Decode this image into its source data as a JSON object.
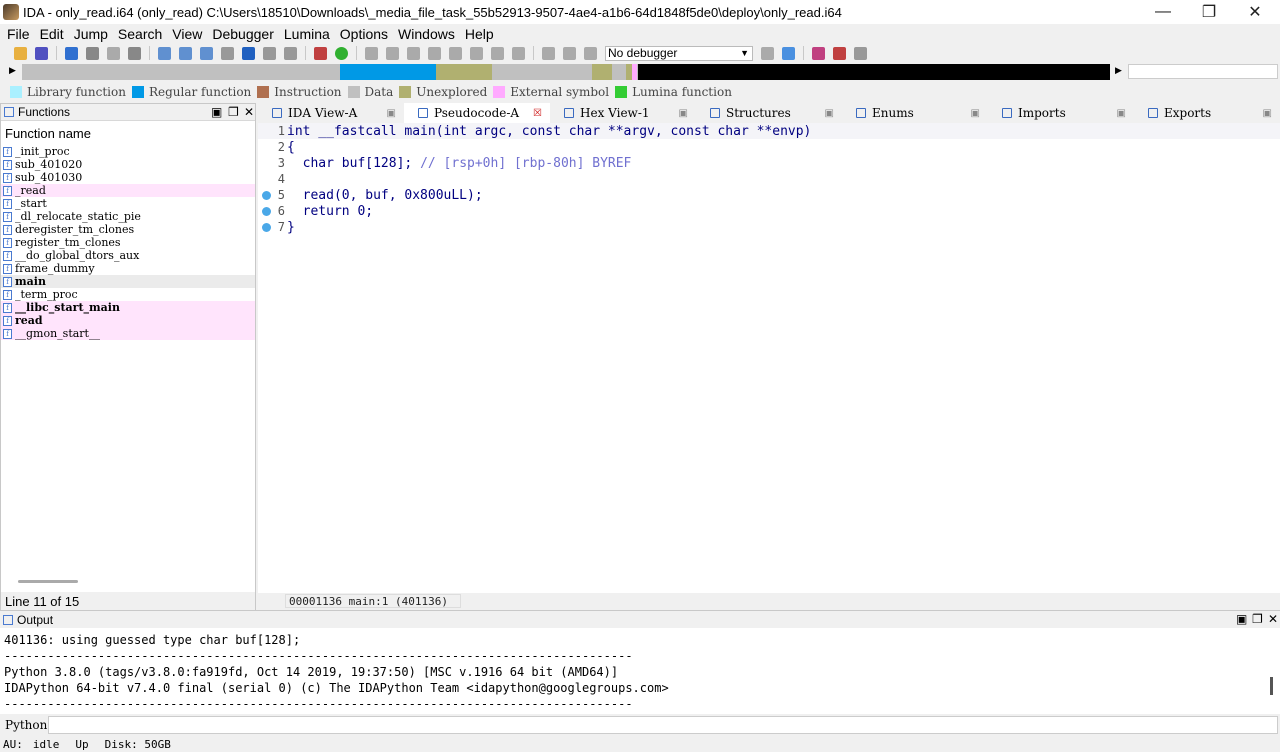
{
  "window": {
    "title": "IDA - only_read.i64 (only_read) C:\\Users\\18510\\Downloads\\_media_file_task_55b52913-9507-4ae4-a1b6-64d1848f5de0\\deploy\\only_read.i64",
    "minimize": "—",
    "maximize": "❐",
    "close": "✕"
  },
  "menu": [
    "File",
    "Edit",
    "Jump",
    "Search",
    "View",
    "Debugger",
    "Lumina",
    "Options",
    "Windows",
    "Help"
  ],
  "toolbar": {
    "debugger": "No debugger"
  },
  "legend": [
    {
      "label": "Library function",
      "color": "#aaf0ff"
    },
    {
      "label": "Regular function",
      "color": "#0099e6"
    },
    {
      "label": "Instruction",
      "color": "#b07050"
    },
    {
      "label": "Data",
      "color": "#c0c0c0"
    },
    {
      "label": "Unexplored",
      "color": "#b0b070"
    },
    {
      "label": "External symbol",
      "color": "#ffaaff"
    },
    {
      "label": "Lumina function",
      "color": "#33cc33"
    }
  ],
  "functions": {
    "title": "Functions",
    "column": "Function name",
    "items": [
      {
        "name": "_init_proc",
        "style": ""
      },
      {
        "name": "sub_401020",
        "style": ""
      },
      {
        "name": "sub_401030",
        "style": ""
      },
      {
        "name": "_read",
        "style": "pink"
      },
      {
        "name": "_start",
        "style": ""
      },
      {
        "name": "_dl_relocate_static_pie",
        "style": ""
      },
      {
        "name": "deregister_tm_clones",
        "style": ""
      },
      {
        "name": "register_tm_clones",
        "style": ""
      },
      {
        "name": "__do_global_dtors_aux",
        "style": ""
      },
      {
        "name": "frame_dummy",
        "style": ""
      },
      {
        "name": "main",
        "style": "sel"
      },
      {
        "name": "_term_proc",
        "style": ""
      },
      {
        "name": "__libc_start_main",
        "style": "pink"
      },
      {
        "name": "read",
        "style": "pink"
      },
      {
        "name": "__gmon_start__",
        "style": "pink"
      }
    ],
    "status": "Line 11 of 15"
  },
  "tabs": [
    "IDA View-A",
    "Pseudocode-A",
    "Hex View-1",
    "Structures",
    "Enums",
    "Imports",
    "Exports"
  ],
  "code": {
    "lines": [
      {
        "n": "1",
        "bp": false,
        "text": "int __fastcall main(int argc, const char **argv, const char **envp)",
        "comment": ""
      },
      {
        "n": "2",
        "bp": false,
        "text": "{",
        "comment": ""
      },
      {
        "n": "3",
        "bp": false,
        "text": "  char buf[128]; ",
        "comment": "// [rsp+0h] [rbp-80h] BYREF"
      },
      {
        "n": "4",
        "bp": false,
        "text": "",
        "comment": ""
      },
      {
        "n": "5",
        "bp": true,
        "text": "  read(0, buf, 0x800uLL);",
        "comment": ""
      },
      {
        "n": "6",
        "bp": true,
        "text": "  return 0;",
        "comment": ""
      },
      {
        "n": "7",
        "bp": true,
        "text": "}",
        "comment": ""
      }
    ],
    "status": "00001136 main:1 (401136)"
  },
  "output": {
    "title": "Output",
    "lines": [
      "401136: using guessed type char buf[128];",
      "---------------------------------------------------------------------------------------",
      "Python 3.8.0 (tags/v3.8.0:fa919fd, Oct 14 2019, 19:37:50) [MSC v.1916 64 bit (AMD64)]",
      "IDAPython 64-bit v7.4.0 final (serial 0) (c) The IDAPython Team <idapython@googlegroups.com>",
      "---------------------------------------------------------------------------------------"
    ]
  },
  "python_label": "Python",
  "statusbar": {
    "au": "AU:",
    "state": "idle",
    "up": "Up",
    "disk": "Disk: 50GB"
  }
}
